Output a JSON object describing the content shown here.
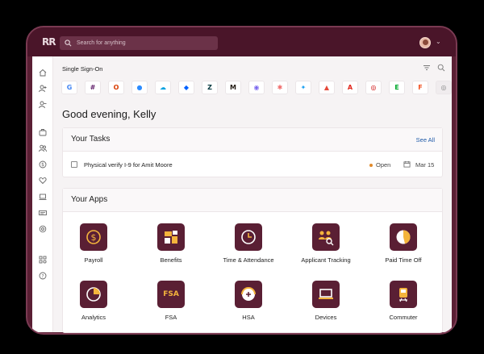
{
  "topbar": {
    "logo": "RR",
    "search_placeholder": "Search for anything"
  },
  "sso": {
    "title": "Single Sign-On",
    "apps": [
      {
        "icon": "google-icon",
        "glyph": "G",
        "color": "#4285F4"
      },
      {
        "icon": "slack-icon",
        "glyph": "#",
        "color": "#611f69"
      },
      {
        "icon": "office-icon",
        "glyph": "O",
        "color": "#D83B01"
      },
      {
        "icon": "zoom-icon",
        "glyph": "●",
        "color": "#2D8CFF"
      },
      {
        "icon": "salesforce-icon",
        "glyph": "☁",
        "color": "#00A1E0"
      },
      {
        "icon": "dropbox-icon",
        "glyph": "◆",
        "color": "#0061FF"
      },
      {
        "icon": "zendesk-icon",
        "glyph": "Z",
        "color": "#03363D"
      },
      {
        "icon": "mailchimp-icon",
        "glyph": "M",
        "color": "#241C15"
      },
      {
        "icon": "clickup-icon",
        "glyph": "◉",
        "color": "#7B68EE"
      },
      {
        "icon": "asana-icon",
        "glyph": "✱",
        "color": "#F06A6A"
      },
      {
        "icon": "twitter-icon",
        "glyph": "✦",
        "color": "#1DA1F2"
      },
      {
        "icon": "atlassian-icon",
        "glyph": "▲",
        "color": "#E5493A"
      },
      {
        "icon": "adobe-icon",
        "glyph": "A",
        "color": "#E1251B"
      },
      {
        "icon": "target-icon",
        "glyph": "◎",
        "color": "#CC0000"
      },
      {
        "icon": "evernote-icon",
        "glyph": "E",
        "color": "#00A82D"
      },
      {
        "icon": "figma-icon",
        "glyph": "F",
        "color": "#F24E1E"
      },
      {
        "icon": "more-icon",
        "glyph": "◎",
        "color": "#888888"
      }
    ]
  },
  "greeting": "Good evening, Kelly",
  "tasks": {
    "title": "Your Tasks",
    "see_all": "See All",
    "items": [
      {
        "text": "Physical verify I-9 for Amit Moore",
        "status": "Open",
        "due": "Mar 15"
      }
    ]
  },
  "apps": {
    "title": "Your Apps",
    "items": [
      {
        "label": "Payroll",
        "icon": "dollar-icon"
      },
      {
        "label": "Benefits",
        "icon": "benefits-icon"
      },
      {
        "label": "Time & Attendance",
        "icon": "clock-icon"
      },
      {
        "label": "Applicant Tracking",
        "icon": "applicant-icon"
      },
      {
        "label": "Paid Time Off",
        "icon": "beach-ball-icon"
      },
      {
        "label": "Analytics",
        "icon": "pie-chart-icon"
      },
      {
        "label": "FSA",
        "icon": "fsa-icon",
        "icon_text": "FSA"
      },
      {
        "label": "HSA",
        "icon": "hsa-icon"
      },
      {
        "label": "Devices",
        "icon": "laptop-icon"
      },
      {
        "label": "Commuter",
        "icon": "train-icon"
      }
    ]
  },
  "colors": {
    "brand": "#5a1f34",
    "accent": "#f4b43c",
    "link": "#1e5aa8"
  }
}
